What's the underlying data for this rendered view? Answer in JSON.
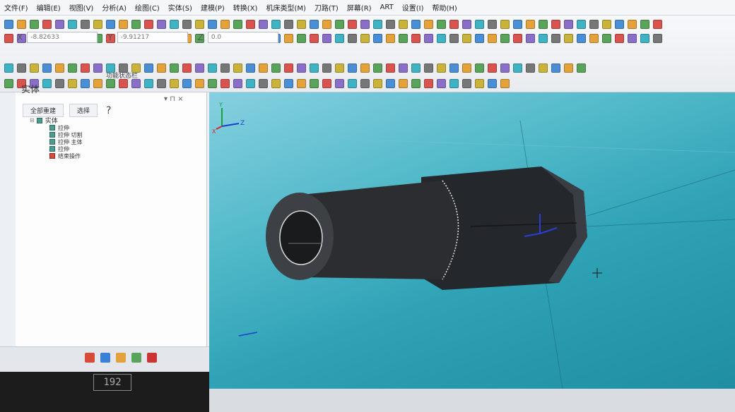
{
  "menu": [
    "文件(F)",
    "编辑(E)",
    "视图(V)",
    "分析(A)",
    "绘图(C)",
    "实体(S)",
    "建模(P)",
    "转换(X)",
    "机床类型(M)",
    "刀路(T)",
    "屏幕(R)",
    "ART",
    "设置(I)",
    "帮助(H)"
  ],
  "coords": {
    "x_label": "X",
    "x_value": "-8.82633",
    "y_label": "Y",
    "y_value": "-9.91217",
    "z_label": "Z",
    "z_value": "0.0"
  },
  "status_caption": "功能状态栏",
  "panel": {
    "title": "实体",
    "header_right": "▾ ⊓ ×",
    "rebuild_all": "全部重建",
    "select": "选择",
    "help": "?"
  },
  "tree": {
    "root": "实体",
    "items": [
      {
        "label": "拉伸",
        "icon": "extrude-icon"
      },
      {
        "label": "拉伸 切割",
        "icon": "extrude-cut-icon"
      },
      {
        "label": "拉伸 主体",
        "icon": "extrude-body-icon"
      },
      {
        "label": "拉伸",
        "icon": "extrude-icon"
      },
      {
        "label": "结束操作",
        "icon": "end-operation-icon"
      }
    ]
  },
  "axes": {
    "z": "Z",
    "x": "X",
    "y": "Y"
  },
  "monitor_label": "192",
  "colors": {
    "viewport_top": "#86d0e0",
    "viewport_bottom": "#1f8ea2",
    "model": "#2b2d30",
    "accent_red": "#d84a3a"
  }
}
